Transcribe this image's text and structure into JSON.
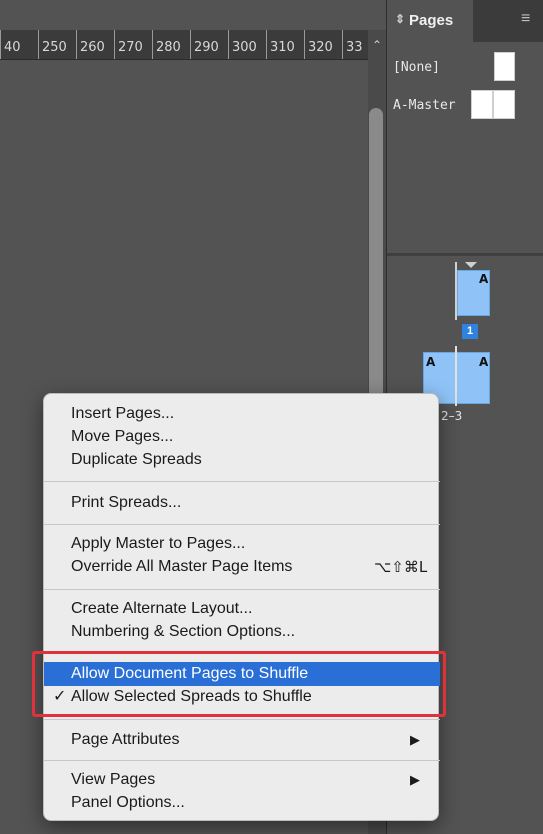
{
  "ruler": {
    "labels": [
      "40",
      "250",
      "260",
      "270",
      "280",
      "290",
      "300",
      "310",
      "320",
      "33"
    ]
  },
  "icons": {
    "scroll_up": "chevron-up-icon",
    "panel_menu": "hamburger-menu-icon",
    "pages_tab": "updown-arrows-icon",
    "submenu": "triangle-right-icon",
    "check": "checkmark-icon"
  },
  "panel": {
    "tab_label": "Pages",
    "masters": [
      {
        "label": "[None]"
      },
      {
        "label": "A-Master"
      }
    ],
    "pages": {
      "page1_prefix": "A",
      "page1_number": "1",
      "spread_prefix_left": "A",
      "spread_prefix_right": "A",
      "spread_label": "2–3"
    }
  },
  "menu": {
    "items": [
      {
        "label": "Insert Pages..."
      },
      {
        "label": "Move Pages..."
      },
      {
        "label": "Duplicate Spreads"
      },
      {
        "label": "Print Spreads..."
      },
      {
        "label": "Apply Master to Pages..."
      },
      {
        "label": "Override All Master Page Items",
        "shortcut": "⌥⇧⌘L"
      },
      {
        "label": "Create Alternate Layout..."
      },
      {
        "label": "Numbering & Section Options..."
      },
      {
        "label": "Allow Document Pages to Shuffle",
        "highlighted": true
      },
      {
        "label": "Allow Selected Spreads to Shuffle",
        "checked": true,
        "check_mark": "✓"
      },
      {
        "label": "Page Attributes",
        "submenu": "▶"
      },
      {
        "label": "View Pages",
        "submenu": "▶"
      },
      {
        "label": "Panel Options..."
      }
    ]
  },
  "colors": {
    "menu_selection": "#2a6fd6",
    "annotation_box": "#e0323c",
    "page_thumbnail": "#8fc3f7",
    "page_number_badge": "#2f82e0"
  }
}
